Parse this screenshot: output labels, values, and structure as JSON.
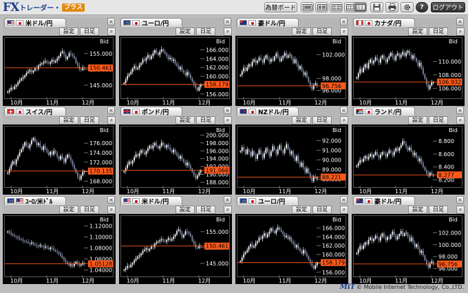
{
  "app": {
    "logo_fx": "FX",
    "logo_trader": "トレーダー・",
    "logo_plus": "プラス"
  },
  "toolbar": {
    "board_label": "為替ボード",
    "logout_label": "ログアウト",
    "help_label": "?",
    "icons": [
      "layout-1x1-icon",
      "layout-2x1-icon",
      "layout-2x2-icon",
      "layout-3x2-icon",
      "layout-4x3-icon",
      "save-icon",
      "print-icon",
      "gear-icon",
      "help-icon"
    ]
  },
  "common": {
    "settings_label": "設定",
    "period_label": "日足",
    "bid_label": "Bid",
    "close_glyph": "×",
    "zoom_glyph": "⌕"
  },
  "footer": {
    "logo": "MiT",
    "credit": "© Mobile Internet Technology, Co.,LTD."
  },
  "colors": {
    "price_line": "#ff5a1a",
    "candle_up": "#ffffff",
    "candle_down": "#7f8aa8",
    "panel_bg": "#b6b6b6"
  },
  "panels": [
    {
      "pair": "米ドル/円",
      "flags": [
        "us-flag",
        "jp-flag"
      ],
      "ticks": [
        "155.000",
        "150.000",
        "145.000"
      ],
      "current": "150.461",
      "dates": [
        "10月",
        "11月",
        "12月"
      ],
      "ymin": 141.5,
      "ymax": 158.0,
      "closes": [
        143.0,
        143.5,
        144.2,
        143.8,
        144.6,
        145.1,
        145.9,
        146.5,
        147.1,
        147.5,
        148.1,
        148.9,
        149.3,
        149.8,
        149.0,
        149.6,
        150.3,
        150.1,
        151.2,
        151.6,
        151.9,
        152.3,
        152.6,
        152.0,
        151.8,
        152.4,
        153.0,
        152.2,
        152.7,
        153.4,
        154.1,
        155.2,
        155.7,
        154.6,
        153.2,
        154.0,
        155.1,
        154.8,
        154.3,
        153.6,
        152.0,
        151.2,
        150.0,
        149.8,
        150.6,
        150.5
      ]
    },
    {
      "pair": "ユーロ/円",
      "flags": [
        "eu-flag",
        "jp-flag"
      ],
      "ticks": [
        "166.000",
        "164.000",
        "162.000",
        "160.000",
        "158.000",
        "156.000"
      ],
      "current": "158.179",
      "dates": [
        "10月",
        "11月",
        "12月"
      ],
      "ymin": 155.5,
      "ymax": 167.3,
      "closes": [
        158.5,
        159.3,
        160.1,
        160.5,
        161.0,
        161.8,
        162.3,
        161.6,
        161.9,
        162.6,
        163.0,
        163.8,
        163.5,
        164.2,
        164.8,
        163.9,
        164.6,
        165.2,
        165.9,
        165.3,
        164.8,
        165.6,
        166.1,
        165.6,
        165.2,
        164.6,
        163.9,
        164.2,
        163.5,
        163.8,
        162.9,
        162.4,
        161.6,
        162.1,
        161.4,
        160.8,
        160.2,
        161.0,
        160.3,
        159.6,
        158.8,
        158.1,
        157.4,
        156.8,
        157.6,
        158.2
      ]
    },
    {
      "pair": "豪ドル/円",
      "flags": [
        "au-flag",
        "jp-flag"
      ],
      "ticks": [
        "102.000",
        "98.000",
        "96.000"
      ],
      "current": "96.756",
      "dates": [
        "10月",
        "11月",
        "12月"
      ],
      "ymin": 95.0,
      "ymax": 103.8,
      "closes": [
        98.6,
        99.2,
        99.8,
        99.3,
        99.9,
        100.4,
        100.1,
        100.8,
        101.2,
        100.6,
        101.0,
        101.5,
        101.1,
        100.7,
        101.4,
        101.9,
        101.2,
        100.8,
        101.3,
        101.0,
        101.7,
        102.2,
        101.6,
        100.9,
        101.4,
        101.8,
        102.3,
        101.5,
        101.9,
        102.0,
        101.4,
        100.6,
        101.2,
        100.4,
        99.6,
        100.1,
        99.3,
        98.6,
        99.0,
        98.2,
        97.4,
        96.8,
        96.2,
        96.9,
        97.2,
        96.8
      ]
    },
    {
      "pair": "カナダ/円",
      "flags": [
        "ca-flag",
        "jp-flag"
      ],
      "ticks": [
        "110.000",
        "108.000",
        "106.000"
      ],
      "current": "106.932",
      "dates": [
        "10月",
        "11月",
        "12月"
      ],
      "ymin": 104.8,
      "ymax": 112.6,
      "closes": [
        107.6,
        108.2,
        108.9,
        108.4,
        109.1,
        109.6,
        109.0,
        109.8,
        110.3,
        109.7,
        110.1,
        110.6,
        110.2,
        109.8,
        110.5,
        110.9,
        110.3,
        109.9,
        110.4,
        110.8,
        111.3,
        110.7,
        110.2,
        110.9,
        111.2,
        110.6,
        111.0,
        111.4,
        110.8,
        111.3,
        111.6,
        111.0,
        110.4,
        110.9,
        110.5,
        110.0,
        109.3,
        109.8,
        109.0,
        108.1,
        107.4,
        106.6,
        105.9,
        106.4,
        106.9,
        106.9
      ]
    },
    {
      "pair": "スイス/円",
      "flags": [
        "ch-flag",
        "jp-flag"
      ],
      "ticks": [
        "176.000",
        "174.000",
        "172.000",
        "170.000",
        "168.000"
      ],
      "current": "170.135",
      "dates": [
        "10月",
        "11月",
        "12月"
      ],
      "ymin": 167.2,
      "ymax": 178.2,
      "closes": [
        169.8,
        170.6,
        171.5,
        172.2,
        171.6,
        172.6,
        173.3,
        174.1,
        174.7,
        175.4,
        176.2,
        175.5,
        175.0,
        175.8,
        176.6,
        177.1,
        176.3,
        175.6,
        176.0,
        175.2,
        174.6,
        175.4,
        174.8,
        174.1,
        173.5,
        174.2,
        173.6,
        174.4,
        173.9,
        173.2,
        172.6,
        173.3,
        172.7,
        172.0,
        172.9,
        173.6,
        173.0,
        172.3,
        171.4,
        170.6,
        169.8,
        169.0,
        168.4,
        169.2,
        170.0,
        170.1
      ]
    },
    {
      "pair": "ポンド/円",
      "flags": [
        "gb-flag",
        "jp-flag"
      ],
      "ticks": [
        "200.000",
        "198.000",
        "196.000",
        "194.000",
        "192.000",
        "190.000",
        "188.000"
      ],
      "current": "191.066",
      "dates": [
        "10月",
        "11月",
        "12月"
      ],
      "ymin": 187.3,
      "ymax": 200.6,
      "closes": [
        190.8,
        191.6,
        192.5,
        193.3,
        192.7,
        193.5,
        194.4,
        195.1,
        194.6,
        195.4,
        196.2,
        195.6,
        195.1,
        195.9,
        196.6,
        197.3,
        196.6,
        197.4,
        198.0,
        197.2,
        196.6,
        197.2,
        198.1,
        197.4,
        196.8,
        197.5,
        196.9,
        196.2,
        195.6,
        196.3,
        195.5,
        194.8,
        194.0,
        194.7,
        193.9,
        193.1,
        192.3,
        193.0,
        192.2,
        191.4,
        190.6,
        189.8,
        189.0,
        189.7,
        190.5,
        191.1
      ]
    },
    {
      "pair": "NZドル/円",
      "flags": [
        "nz-flag",
        "jp-flag"
      ],
      "ticks": [
        "92.000",
        "91.000",
        "90.000",
        "89.000",
        "88.000"
      ],
      "current": "88.221",
      "dates": [
        "10月",
        "11月",
        "12月"
      ],
      "ymin": 87.4,
      "ymax": 92.8,
      "closes": [
        90.9,
        91.3,
        91.0,
        90.6,
        91.1,
        90.8,
        90.4,
        90.9,
        90.5,
        90.1,
        90.6,
        91.0,
        90.6,
        90.2,
        90.7,
        91.2,
        90.8,
        90.4,
        90.9,
        91.4,
        91.0,
        90.6,
        91.1,
        91.5,
        91.0,
        90.7,
        91.2,
        91.6,
        91.1,
        90.6,
        90.9,
        90.3,
        89.9,
        90.4,
        89.8,
        89.3,
        89.7,
        89.2,
        88.7,
        89.1,
        88.6,
        88.2,
        87.8,
        88.3,
        88.1,
        88.2
      ]
    },
    {
      "pair": "ランド/円",
      "flags": [
        "za-flag",
        "jp-flag"
      ],
      "ticks": [
        "8.800",
        "8.600",
        "8.400",
        "8.200"
      ],
      "current": "8.277",
      "dates": [
        "10月",
        "11月",
        "12月"
      ],
      "ymin": 8.12,
      "ymax": 8.93,
      "closes": [
        8.42,
        8.46,
        8.51,
        8.48,
        8.53,
        8.57,
        8.52,
        8.56,
        8.6,
        8.55,
        8.59,
        8.63,
        8.58,
        8.54,
        8.59,
        8.63,
        8.6,
        8.56,
        8.61,
        8.66,
        8.62,
        8.58,
        8.64,
        8.69,
        8.65,
        8.7,
        8.74,
        8.8,
        8.76,
        8.71,
        8.66,
        8.7,
        8.64,
        8.58,
        8.62,
        8.55,
        8.49,
        8.53,
        8.46,
        8.4,
        8.35,
        8.3,
        8.26,
        8.31,
        8.28,
        8.28
      ]
    },
    {
      "pair": "ﾕｰﾛ/米ﾄﾞﾙ",
      "flags": [
        "eu-flag",
        "us-flag"
      ],
      "ticks": [
        "1.12000",
        "1.10000",
        "1.08000",
        "1.06000",
        "1.04000"
      ],
      "current": "1.05128",
      "dates": [
        "10月",
        "11月",
        "12月"
      ],
      "ymin": 1.032,
      "ymax": 1.127,
      "closes": [
        1.11,
        1.108,
        1.105,
        1.103,
        1.101,
        1.1,
        1.098,
        1.096,
        1.095,
        1.093,
        1.092,
        1.091,
        1.089,
        1.088,
        1.09,
        1.087,
        1.085,
        1.084,
        1.083,
        1.085,
        1.082,
        1.081,
        1.083,
        1.08,
        1.078,
        1.081,
        1.079,
        1.076,
        1.074,
        1.073,
        1.07,
        1.066,
        1.062,
        1.058,
        1.055,
        1.052,
        1.048,
        1.05,
        1.047,
        1.052,
        1.055,
        1.051,
        1.048,
        1.05,
        1.053,
        1.051
      ]
    },
    {
      "pair": "米ドル/円",
      "flags": [
        "us-flag",
        "jp-flag"
      ],
      "ticks": [
        "155.000",
        "150.000",
        "145.000"
      ],
      "current": "150.461",
      "dates": [
        "10月",
        "11月",
        "12月"
      ],
      "ymin": 141.5,
      "ymax": 158.0,
      "closes": [
        143.0,
        143.5,
        144.2,
        143.8,
        144.6,
        145.1,
        145.9,
        146.5,
        147.1,
        147.5,
        148.1,
        148.9,
        149.3,
        149.8,
        149.0,
        149.6,
        150.3,
        150.1,
        151.2,
        151.6,
        151.9,
        152.3,
        152.6,
        152.0,
        151.8,
        152.4,
        153.0,
        152.2,
        152.7,
        153.4,
        154.1,
        155.2,
        155.7,
        154.6,
        153.2,
        154.0,
        155.1,
        154.8,
        154.3,
        153.6,
        152.0,
        151.2,
        150.0,
        149.8,
        150.6,
        150.5
      ]
    },
    {
      "pair": "ユーロ/円",
      "flags": [
        "eu-flag",
        "jp-flag"
      ],
      "ticks": [
        "166.000",
        "164.000",
        "162.000",
        "160.000",
        "158.000",
        "156.000"
      ],
      "current": "158.179",
      "dates": [
        "10月",
        "11月",
        "12月"
      ],
      "ymin": 155.5,
      "ymax": 167.3,
      "closes": [
        158.5,
        159.3,
        160.1,
        160.5,
        161.0,
        161.8,
        162.3,
        161.6,
        161.9,
        162.6,
        163.0,
        163.8,
        163.5,
        164.2,
        164.8,
        163.9,
        164.6,
        165.2,
        165.9,
        165.3,
        164.8,
        165.6,
        166.1,
        165.6,
        165.2,
        164.6,
        163.9,
        164.2,
        163.5,
        163.8,
        162.9,
        162.4,
        161.6,
        162.1,
        161.4,
        160.8,
        160.2,
        161.0,
        160.3,
        159.6,
        158.8,
        158.1,
        157.4,
        156.8,
        157.6,
        158.2
      ]
    },
    {
      "pair": "豪ドル/円",
      "flags": [
        "au-flag",
        "jp-flag"
      ],
      "ticks": [
        "102.000",
        "100.000",
        "98.000",
        "96.000"
      ],
      "current": "96.756",
      "dates": [
        "10月",
        "11月",
        "12月"
      ],
      "ymin": 95.0,
      "ymax": 103.8,
      "closes": [
        98.6,
        99.2,
        99.8,
        99.3,
        99.9,
        100.4,
        100.1,
        100.8,
        101.2,
        100.6,
        101.0,
        101.5,
        101.1,
        100.7,
        101.4,
        101.9,
        101.2,
        100.8,
        101.3,
        101.0,
        101.7,
        102.2,
        101.6,
        100.9,
        101.4,
        101.8,
        102.3,
        101.5,
        101.9,
        102.0,
        101.4,
        100.6,
        101.2,
        100.4,
        99.6,
        100.1,
        99.3,
        98.6,
        99.0,
        98.2,
        97.4,
        96.8,
        96.2,
        96.9,
        97.2,
        96.8
      ]
    }
  ]
}
